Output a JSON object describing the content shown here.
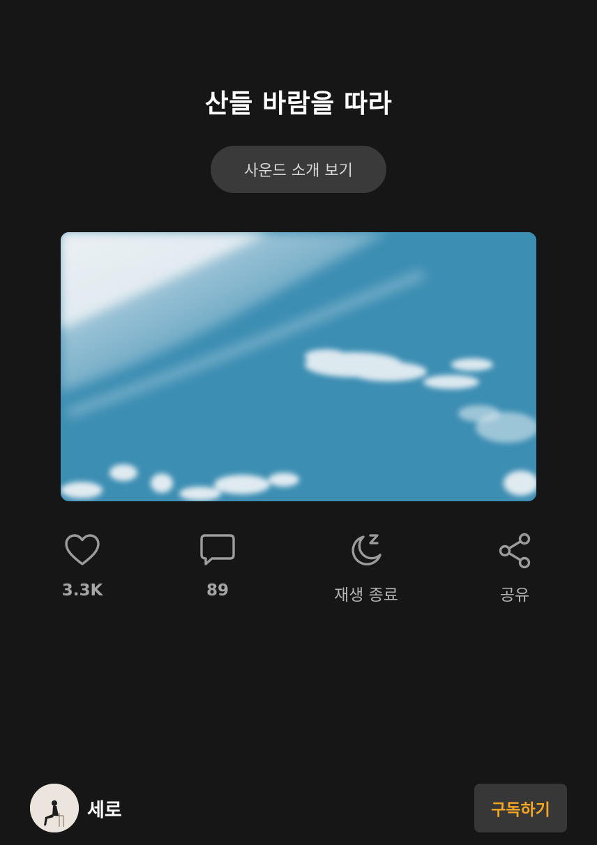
{
  "sound": {
    "title": "산들 바람을 따라",
    "intro_button_label": "사운드 소개 보기"
  },
  "actions": {
    "like": {
      "icon": "heart-icon",
      "label": "3.3K"
    },
    "comment": {
      "icon": "chat-bubble-icon",
      "label": "89"
    },
    "sleep_timer": {
      "icon": "moon-zzz-icon",
      "label": "재생 종료"
    },
    "share": {
      "icon": "share-icon",
      "label": "공유"
    }
  },
  "creator": {
    "name": "세로",
    "subscribe_label": "구독하기"
  },
  "colors": {
    "background": "#161616",
    "accent": "#f5a623",
    "pill": "#3a3a3a",
    "icon_gray": "#9c9c9c"
  }
}
